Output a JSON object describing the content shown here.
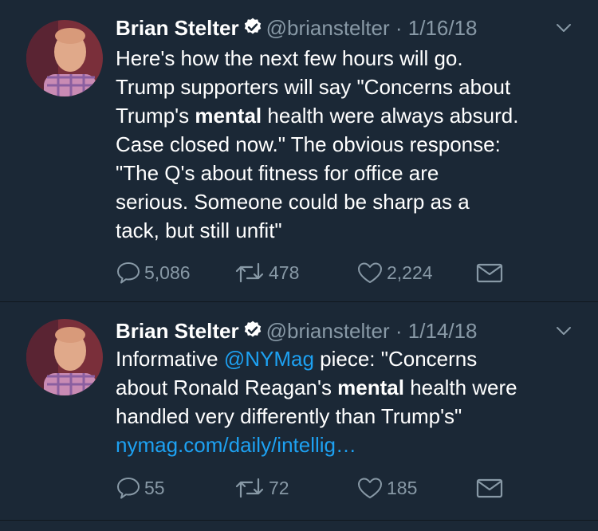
{
  "colors": {
    "background": "#1b2836",
    "link": "#1da1f2",
    "muted": "#8899a6",
    "text": "#ffffff"
  },
  "tweets": [
    {
      "author": {
        "name": "Brian Stelter",
        "handle": "@brianstelter",
        "verified_icon": "verified-badge-icon"
      },
      "separator": "·",
      "date": "1/16/18",
      "lines": [
        [
          "Here's how the next few hours will go."
        ],
        [
          "Trump supporters will say \"Concerns about"
        ],
        [
          "Trump's ",
          "mental",
          " health were always absurd."
        ],
        [
          "Case closed now.\" The obvious response:"
        ],
        [
          "\"The Q's about fitness for office are"
        ],
        [
          "serious. Someone could be sharp as a"
        ],
        [
          "tack, but still unfit\""
        ]
      ],
      "counts": {
        "replies": "5,086",
        "retweets": "478",
        "likes": "2,224"
      }
    },
    {
      "author": {
        "name": "Brian Stelter",
        "handle": "@brianstelter",
        "verified_icon": "verified-badge-icon"
      },
      "separator": "·",
      "date": "1/14/18",
      "lines": [
        [
          "Informative ",
          "@NYMag",
          " piece: \"Concerns"
        ],
        [
          "about Ronald Reagan's ",
          "mental",
          " health were"
        ],
        [
          "handled very differently than Trump's\""
        ],
        [
          "nymag.com/daily/intellig…"
        ]
      ],
      "counts": {
        "replies": "55",
        "retweets": "72",
        "likes": "185"
      }
    }
  ]
}
